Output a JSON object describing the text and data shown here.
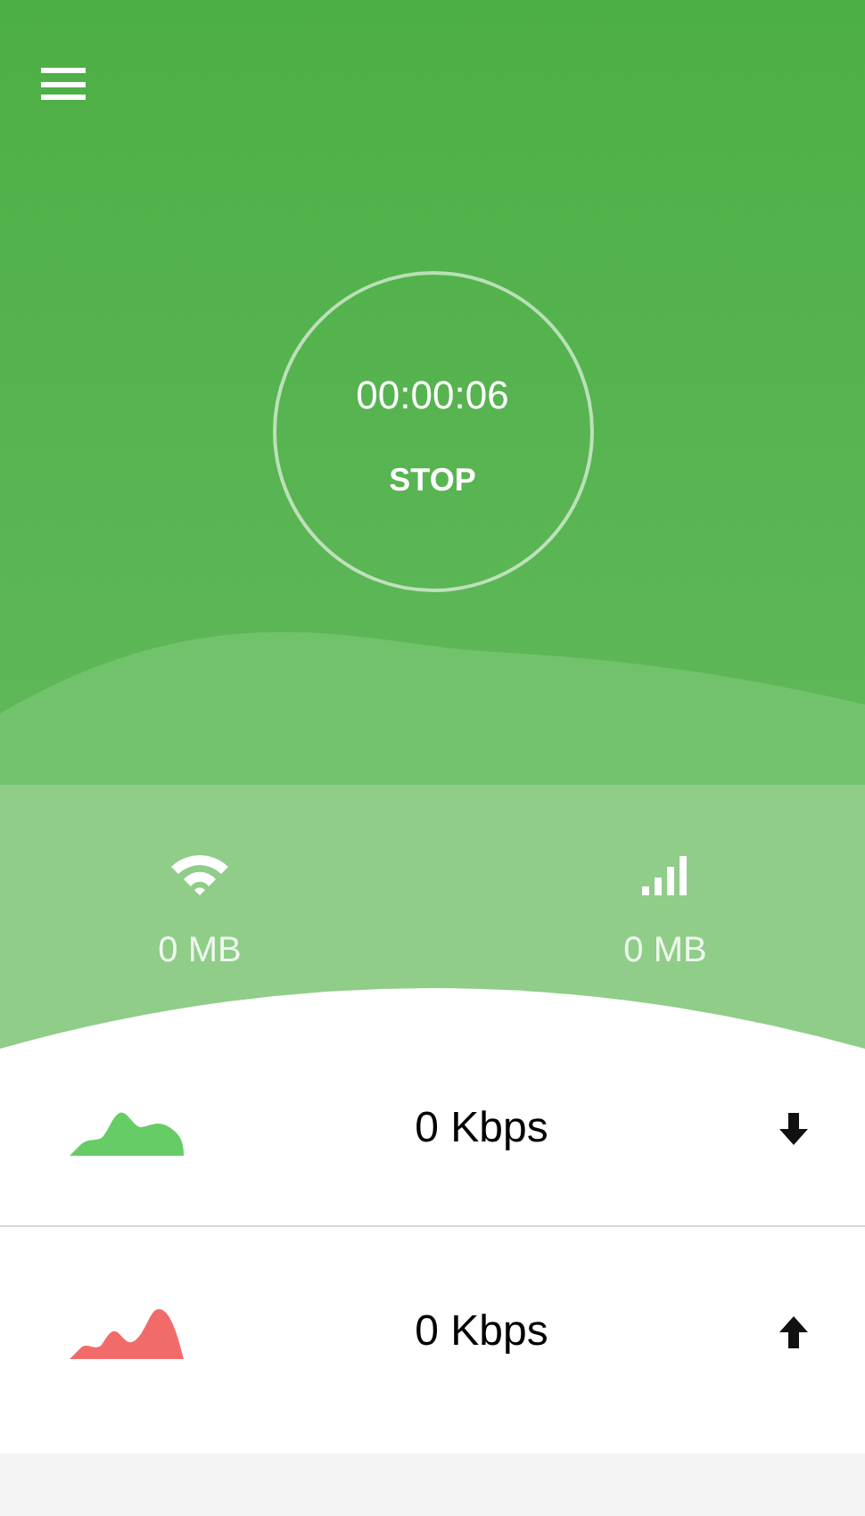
{
  "timer": {
    "elapsed": "00:00:06",
    "button": "STOP"
  },
  "usage": [
    {
      "kind": "wifi",
      "amount": "0 MB"
    },
    {
      "kind": "cellular",
      "amount": "0 MB"
    }
  ],
  "speeds": [
    {
      "kind": "download",
      "color": "#66cc66",
      "rate": "0 Kbps"
    },
    {
      "kind": "upload",
      "color": "#f26b6b",
      "rate": "0 Kbps"
    }
  ]
}
